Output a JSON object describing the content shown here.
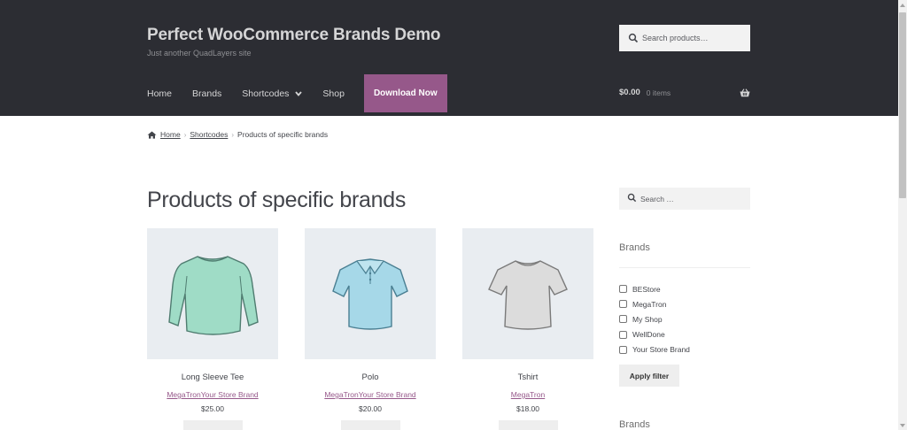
{
  "header": {
    "site_title": "Perfect WooCommerce Brands Demo",
    "tagline": "Just another QuadLayers site",
    "search_placeholder": "Search products…"
  },
  "nav": {
    "items": [
      {
        "label": "Home"
      },
      {
        "label": "Brands"
      },
      {
        "label": "Shortcodes"
      },
      {
        "label": "Shop"
      }
    ],
    "cta_label": "Download Now"
  },
  "cart": {
    "total": "$0.00",
    "count": "0 items"
  },
  "breadcrumb": {
    "home": "Home",
    "shortcodes": "Shortcodes",
    "current": "Products of specific brands"
  },
  "page": {
    "title": "Products of specific brands"
  },
  "products": [
    {
      "name": "Long Sleeve Tee",
      "brand": "MegaTronYour Store Brand",
      "price": "$25.00",
      "shirt_color": "#9fdcc6"
    },
    {
      "name": "Polo",
      "brand": "MegaTronYour Store Brand",
      "price": "$20.00",
      "shirt_color": "#a6d8e8"
    },
    {
      "name": "Tshirt",
      "brand": "MegaTron",
      "price": "$18.00",
      "shirt_color": "#dcdcdc"
    }
  ],
  "sidebar": {
    "search_placeholder": "Search …",
    "brands_title": "Brands",
    "brand_options": [
      "BEStore",
      "MegaTron",
      "My Shop",
      "WellDone",
      "Your Store Brand"
    ],
    "apply_label": "Apply filter",
    "brands_title_2": "Brands"
  },
  "colors": {
    "header_bg": "#2c2d33",
    "accent": "#96588a",
    "thumb_bg": "#e9edf1"
  }
}
